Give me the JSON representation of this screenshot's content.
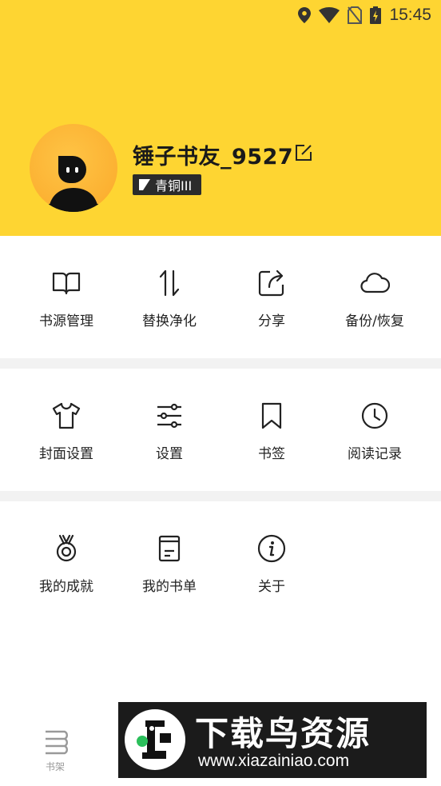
{
  "status_bar": {
    "time": "15:45",
    "icons": [
      "location-icon",
      "wifi-icon",
      "no-sim-icon",
      "battery-charging-icon"
    ]
  },
  "profile": {
    "username": "锤子书友_9527",
    "level_badge": "青铜III"
  },
  "colors": {
    "header_bg": "#FED532",
    "section_gap": "#F2F2F2",
    "badge_bg": "#2b2b2b"
  },
  "menu": {
    "row1": [
      {
        "label": "书源管理",
        "icon": "book-open-icon"
      },
      {
        "label": "替换净化",
        "icon": "swap-vertical-icon"
      },
      {
        "label": "分享",
        "icon": "share-icon"
      },
      {
        "label": "备份/恢复",
        "icon": "cloud-icon"
      }
    ],
    "row2": [
      {
        "label": "封面设置",
        "icon": "shirt-icon"
      },
      {
        "label": "设置",
        "icon": "sliders-icon"
      },
      {
        "label": "书签",
        "icon": "bookmark-icon"
      },
      {
        "label": "阅读记录",
        "icon": "clock-icon"
      }
    ],
    "row3": [
      {
        "label": "我的成就",
        "icon": "medal-icon"
      },
      {
        "label": "我的书单",
        "icon": "booklist-icon"
      },
      {
        "label": "关于",
        "icon": "info-icon"
      }
    ]
  },
  "bottom_nav": {
    "bookshelf_label": "书架"
  },
  "watermark": {
    "title": "下载鸟资源",
    "url": "www.xiazainiao.com"
  }
}
